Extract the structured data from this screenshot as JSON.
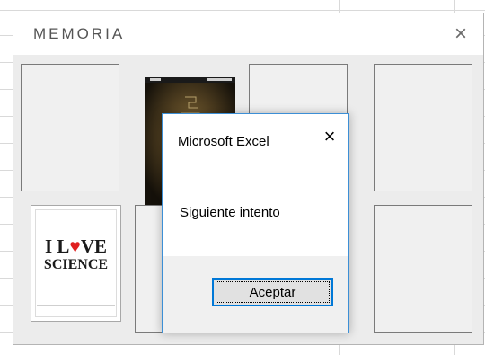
{
  "form": {
    "title": "MEMORIA",
    "close_glyph": "×",
    "cards": [
      {
        "state": "hidden"
      },
      {
        "state": "revealed",
        "image": "dark-maze-poster"
      },
      {
        "state": "hidden"
      },
      {
        "state": "hidden"
      },
      {
        "state": "revealed",
        "image": "i-love-science",
        "text_line1": "I L",
        "heart": "♥",
        "text_line1_end": "VE",
        "text_line2": "SCIENCE"
      },
      {
        "state": "hidden"
      },
      {
        "state": "hidden"
      },
      {
        "state": "hidden"
      }
    ]
  },
  "msgbox": {
    "title": "Microsoft Excel",
    "close_glyph": "×",
    "message": "Siguiente intento",
    "ok_label": "Aceptar",
    "accent": "#0078d7"
  }
}
